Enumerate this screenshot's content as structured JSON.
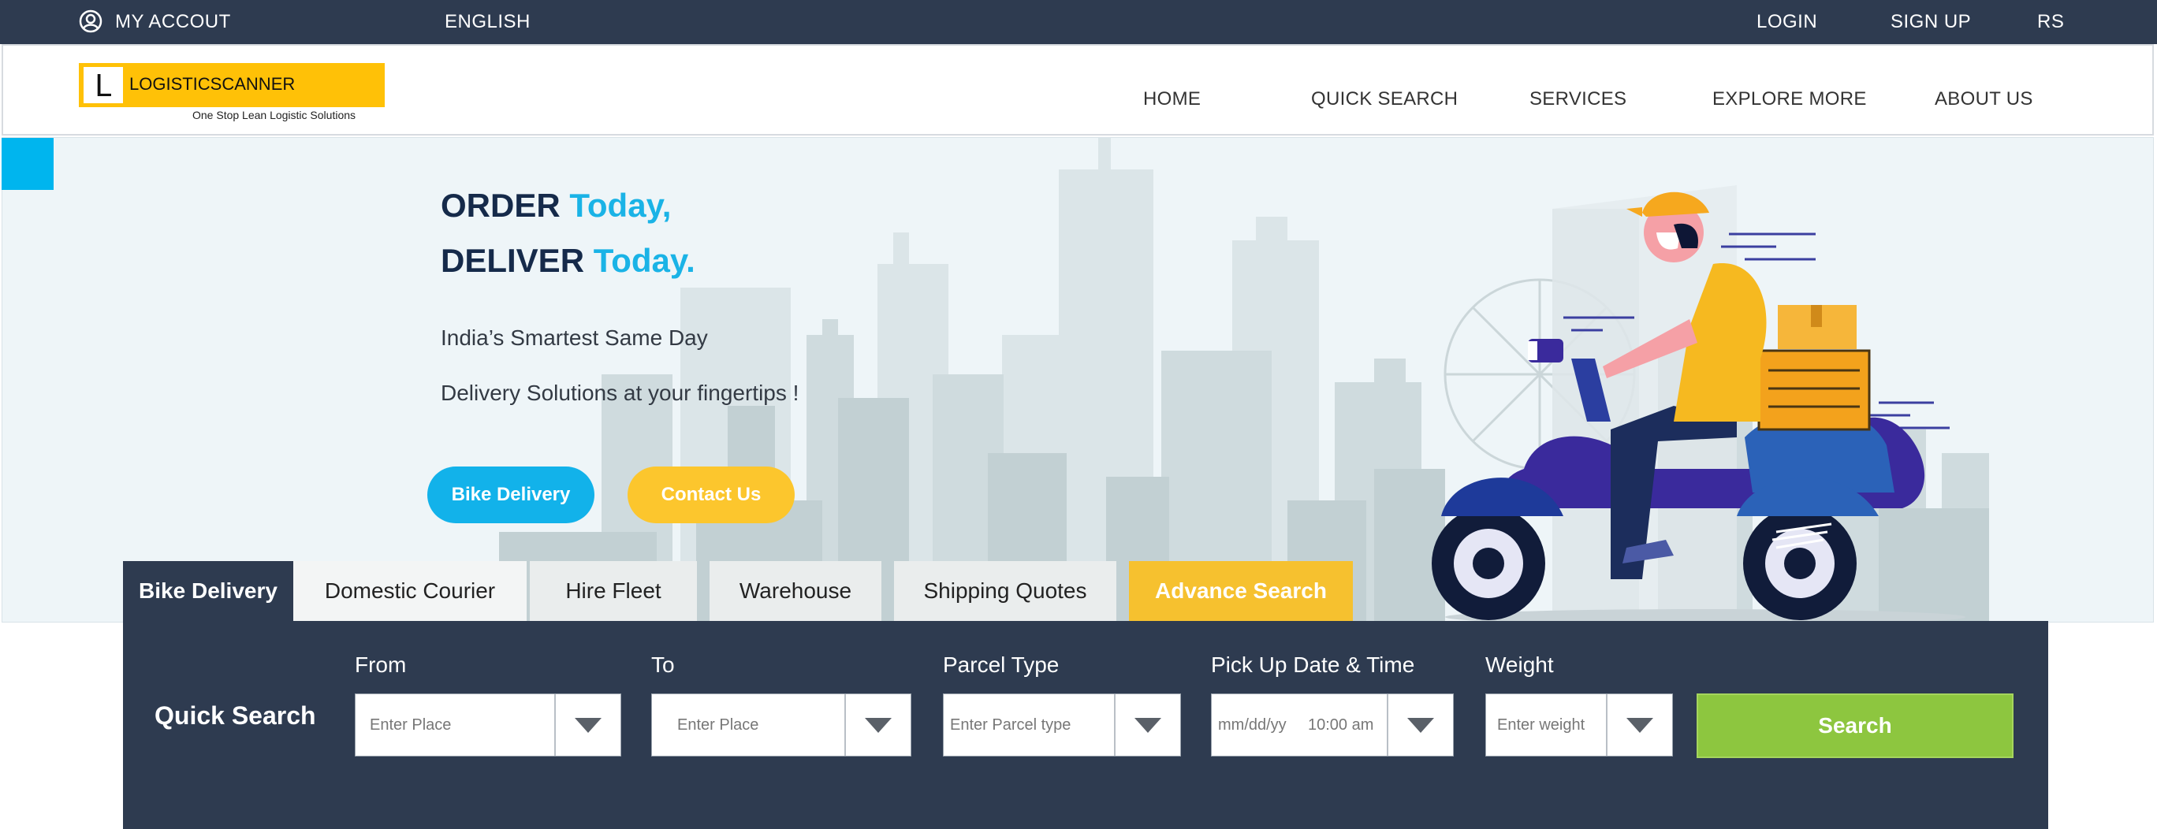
{
  "topbar": {
    "account_label": "MY ACCOUT",
    "language_label": "ENGLISH",
    "login_label": "LOGIN",
    "signup_label": "SIGN UP",
    "currency_label": "RS"
  },
  "header": {
    "logo_letter": "L",
    "logo_name": "LOGISTICSCANNER",
    "tagline": "One Stop Lean Logistic Solutions",
    "nav": [
      "HOME",
      "QUICK SEARCH",
      "SERVICES",
      "EXPLORE MORE",
      "ABOUT  US"
    ]
  },
  "hero": {
    "line1_a": "ORDER ",
    "line1_b": "Today,",
    "line2_a": "DELIVER ",
    "line2_b": "Today.",
    "sub1": "India’s Smartest Same Day",
    "sub2": "Delivery Solutions at your fingertips !",
    "btn_bike": "Bike Delivery",
    "btn_contact": "Contact  Us"
  },
  "tabs": [
    "Bike Delivery",
    "Domestic Courier",
    "Hire Fleet",
    "Warehouse",
    "Shipping Quotes",
    "Advance Search"
  ],
  "search": {
    "title": "Quick Search",
    "from_label": "From",
    "to_label": "To",
    "parcel_label": "Parcel Type",
    "pickup_label": "Pick Up Date & Time",
    "weight_label": "Weight",
    "from_placeholder": "Enter Place",
    "to_placeholder": "Enter Place",
    "parcel_placeholder": "Enter Parcel type",
    "date_placeholder": "mm/dd/yy",
    "time_placeholder": "10:00 am",
    "weight_placeholder": "Enter weight",
    "button": "Search"
  },
  "colors": {
    "navy": "#2e3b50",
    "accent_blue": "#1ab3e6",
    "yellow": "#f6c12f",
    "green": "#8dc63f"
  }
}
